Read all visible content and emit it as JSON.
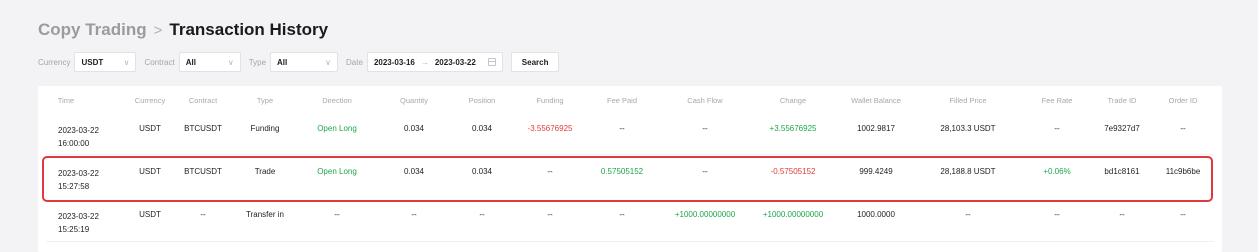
{
  "breadcrumb": {
    "parent": "Copy Trading",
    "separator": ">",
    "current": "Transaction History"
  },
  "filters": {
    "currency_label": "Currency",
    "currency_value": "USDT",
    "contract_label": "Contract",
    "contract_value": "All",
    "type_label": "Type",
    "type_value": "All",
    "date_label": "Date",
    "date_start": "2023-03-16",
    "date_end": "2023-03-22",
    "search_label": "Search"
  },
  "table": {
    "headers": [
      "Time",
      "Currency",
      "Contract",
      "Type",
      "Direction",
      "Quantity",
      "Position",
      "Funding",
      "Fee Paid",
      "Cash Flow",
      "Change",
      "Wallet Balance",
      "Filled Price",
      "Fee Rate",
      "Trade ID",
      "Order ID"
    ],
    "rows": [
      {
        "date": "2023-03-22",
        "time": "16:00:00",
        "currency": "USDT",
        "contract": "BTCUSDT",
        "type": "Funding",
        "direction": "Open Long",
        "quantity": "0.034",
        "position": "0.034",
        "funding": "-3.55676925",
        "fee_paid": "--",
        "cash_flow": "--",
        "change": "+3.55676925",
        "wallet_balance": "1002.9817",
        "filled_price": "28,103.3 USDT",
        "fee_rate": "--",
        "trade_id": "7e9327d7",
        "order_id": "--"
      },
      {
        "date": "2023-03-22",
        "time": "15:27:58",
        "currency": "USDT",
        "contract": "BTCUSDT",
        "type": "Trade",
        "direction": "Open Long",
        "quantity": "0.034",
        "position": "0.034",
        "funding": "--",
        "fee_paid": "0.57505152",
        "cash_flow": "--",
        "change": "-0.57505152",
        "wallet_balance": "999.4249",
        "filled_price": "28,188.8 USDT",
        "fee_rate": "+0.06%",
        "trade_id": "bd1c8161",
        "order_id": "11c9b6be"
      },
      {
        "date": "2023-03-22",
        "time": "15:25:19",
        "currency": "USDT",
        "contract": "--",
        "type": "Transfer in",
        "direction": "--",
        "quantity": "--",
        "position": "--",
        "funding": "--",
        "fee_paid": "--",
        "cash_flow": "+1000.00000000",
        "change": "+1000.00000000",
        "wallet_balance": "1000.0000",
        "filled_price": "--",
        "fee_rate": "--",
        "trade_id": "--",
        "order_id": "--"
      }
    ]
  },
  "colors": {
    "positive": "#1ea64a",
    "negative": "#e03c3c",
    "highlight_border": "#e0383e"
  }
}
